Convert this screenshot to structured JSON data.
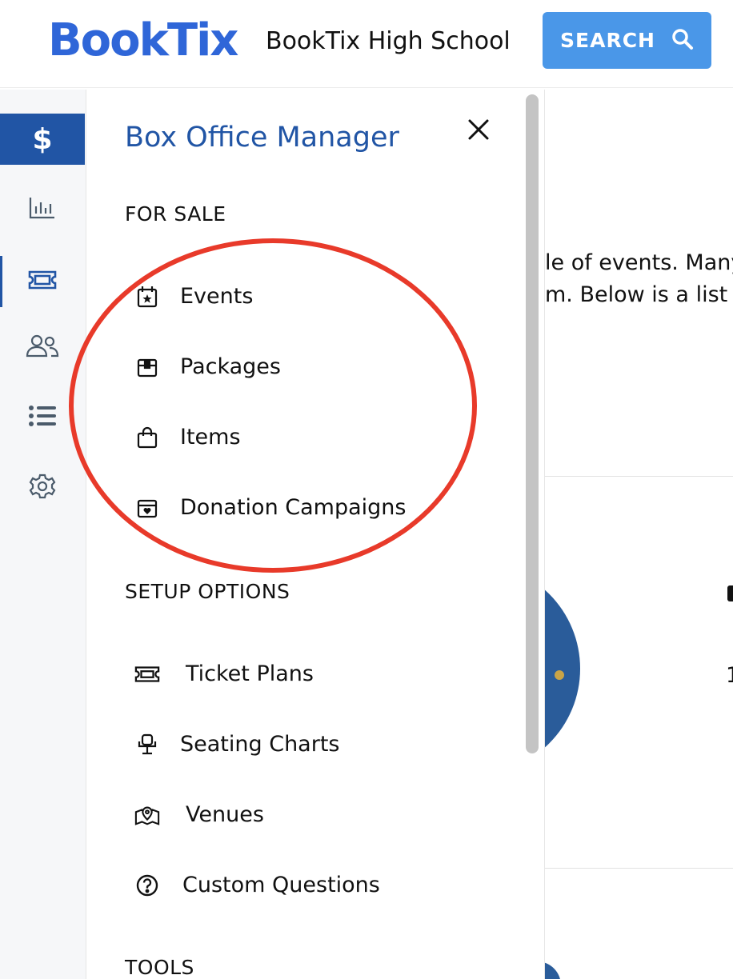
{
  "header": {
    "logo": "BookTix",
    "school_name": "BookTix High School",
    "search_label": "SEARCH"
  },
  "rail": {
    "items": [
      {
        "icon": "dollar-icon",
        "glyph": "$",
        "active": true
      },
      {
        "icon": "chart-icon"
      },
      {
        "icon": "ticket-icon"
      },
      {
        "icon": "users-icon"
      },
      {
        "icon": "list-icon"
      },
      {
        "icon": "gear-icon"
      }
    ]
  },
  "drawer": {
    "title": "Box Office Manager",
    "for_sale_heading": "FOR SALE",
    "for_sale": [
      {
        "label": "Events",
        "icon": "calendar-star-icon"
      },
      {
        "label": "Packages",
        "icon": "package-icon"
      },
      {
        "label": "Items",
        "icon": "shopping-bag-icon"
      },
      {
        "label": "Donation Campaigns",
        "icon": "donation-box-icon"
      }
    ],
    "setup_heading": "SETUP OPTIONS",
    "setup": [
      {
        "label": "Ticket Plans",
        "icon": "ticket-icon"
      },
      {
        "label": "Seating Charts",
        "icon": "seat-icon"
      },
      {
        "label": "Venues",
        "icon": "map-pin-icon"
      },
      {
        "label": "Custom Questions",
        "icon": "question-circle-icon"
      }
    ],
    "tools_heading": "TOOLS"
  },
  "content": {
    "line1": "le of events. Many",
    "line2": "m. Below is a list o",
    "frag_1": "1"
  },
  "colors": {
    "brand": "#2f66d8",
    "primary": "#2155a5",
    "search_button": "#4a97e8",
    "annotation": "#e83a2a"
  }
}
